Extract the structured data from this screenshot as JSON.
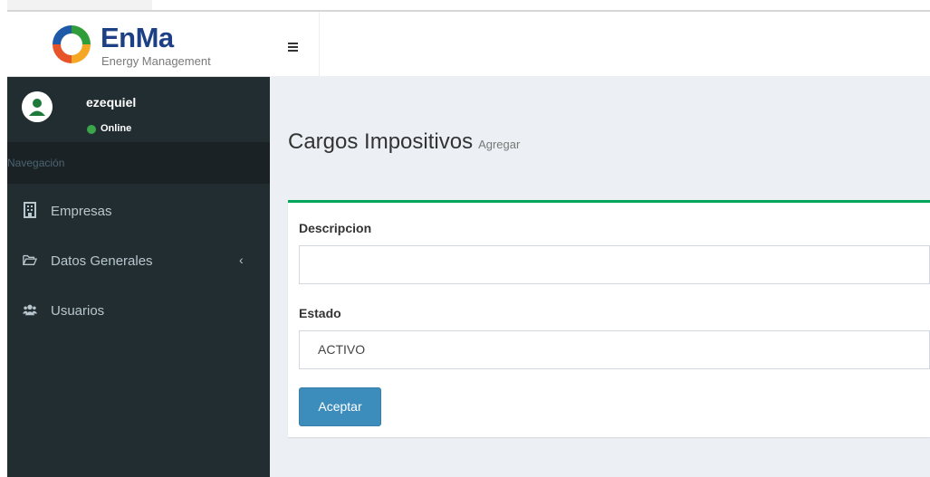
{
  "brand": {
    "title": "EnMa",
    "subtitle": "Energy Management"
  },
  "user": {
    "name": "ezequiel",
    "status": "Online"
  },
  "sidebar": {
    "header": "Navegación",
    "items": [
      {
        "label": "Empresas",
        "icon": "building-icon"
      },
      {
        "label": "Datos Generales",
        "icon": "folder-open-icon",
        "chevron": "‹"
      },
      {
        "label": "Usuarios",
        "icon": "users-icon"
      }
    ]
  },
  "page": {
    "title": "Cargos Impositivos",
    "subtitle": "Agregar"
  },
  "form": {
    "description_label": "Descripcion",
    "description_value": "",
    "status_label": "Estado",
    "status_value": "ACTIVO",
    "submit_label": "Aceptar"
  },
  "colors": {
    "sidebar_bg": "#222d32",
    "content_bg": "#ecf0f5",
    "box_accent": "#00a65a",
    "button_primary": "#3c8dbc",
    "online": "#3aa54a",
    "brand_blue": "#1d3f86"
  }
}
